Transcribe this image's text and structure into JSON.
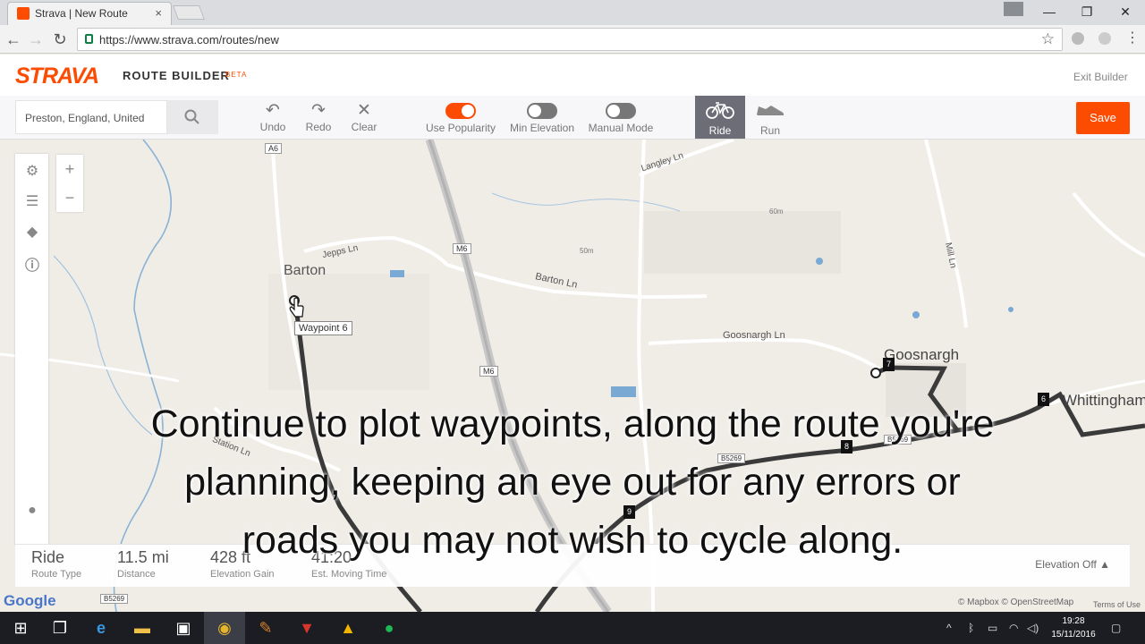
{
  "browser": {
    "tab_title": "Strava | New Route",
    "tab_close": "×",
    "url": "https://www.strava.com/routes/new",
    "window_controls": [
      "—",
      "❐",
      "✕"
    ]
  },
  "header": {
    "logo": "STRAVA",
    "section": "ROUTE BUILDER",
    "badge": "BETA",
    "exit_label": "Exit Builder"
  },
  "toolbar": {
    "search_value": "Preston, England, United",
    "undo": "Undo",
    "redo": "Redo",
    "clear": "Clear",
    "use_popularity": "Use Popularity",
    "use_popularity_on": true,
    "min_elevation": "Min Elevation",
    "min_elevation_on": false,
    "manual_mode": "Manual Mode",
    "manual_mode_on": false,
    "ride": "Ride",
    "run": "Run",
    "save": "Save"
  },
  "map": {
    "labels": {
      "barton": "Barton",
      "goosnargh": "Goosnargh",
      "whittingham": "Whittingham",
      "langley_ln": "Langley Ln",
      "jepps_ln": "Jepps Ln",
      "barton_ln": "Barton Ln",
      "goosnargh_ln": "Goosnargh Ln",
      "mill_ln": "Mill Ln",
      "station_ln": "Station Ln",
      "a6": "A6",
      "m6_a": "M6",
      "m6_b": "M6",
      "b5269_a": "B5269",
      "b5269_b": "B5269",
      "b5269_c": "B5269",
      "contour_60": "60m",
      "contour_50": "50m",
      "tooltip": "Waypoint 6"
    },
    "markers": [
      "6",
      "7",
      "8",
      "9"
    ],
    "google": "Google",
    "attribution": "© Mapbox © OpenStreetMap",
    "terms": "Terms of Use"
  },
  "stats": {
    "route_type": {
      "value": "Ride",
      "label": "Route Type"
    },
    "distance": {
      "value": "11.5 mi",
      "label": "Distance"
    },
    "elevation_gain": {
      "value": "428 ft",
      "label": "Elevation Gain"
    },
    "moving_time": {
      "value": "41:20",
      "label": "Est. Moving Time"
    },
    "elevation_toggle": "Elevation Off ▲"
  },
  "caption": "Continue to plot waypoints, along the route you're planning, keeping an eye out for any errors or roads you may not wish to cycle along.",
  "taskbar": {
    "time": "19:28",
    "date": "15/11/2016"
  },
  "colors": {
    "strava_orange": "#fc4c02",
    "route": "#3a3a3a",
    "taskbar": "#1b1d22"
  }
}
